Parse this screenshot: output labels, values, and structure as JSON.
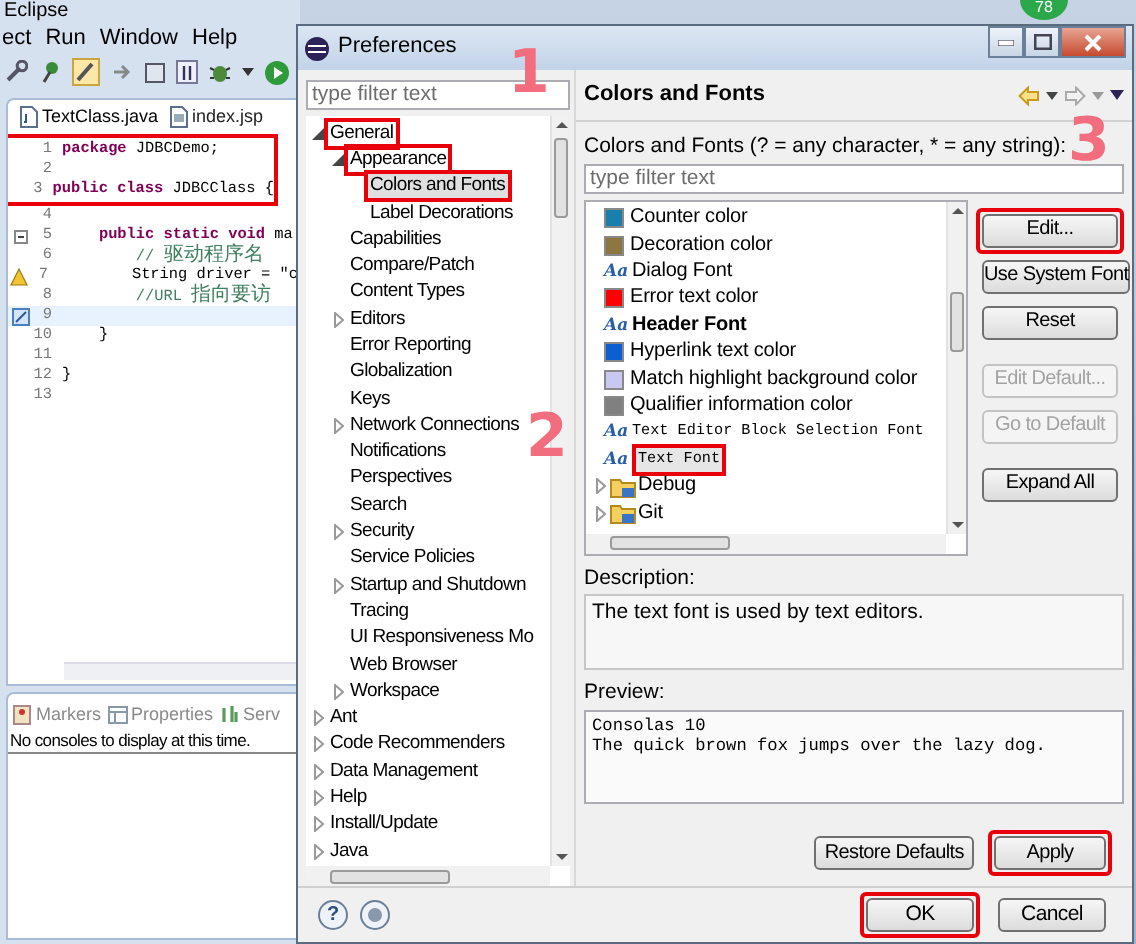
{
  "desktop": {
    "badge": "78"
  },
  "eclipse": {
    "title": "Eclipse",
    "menu": [
      "ect",
      "Run",
      "Window",
      "Help"
    ],
    "editor_tabs": [
      {
        "label": "TextClass.java",
        "selected": true
      },
      {
        "label": "index.jsp",
        "selected": false
      }
    ],
    "code_lines": [
      {
        "number": "1",
        "kind": "code",
        "text": "**package** JDBCDemo;",
        "highlighted": true,
        "current": false
      },
      {
        "number": "2",
        "kind": "blank",
        "highlighted": true,
        "current": false
      },
      {
        "number": "3",
        "kind": "code",
        "text": "**public** **class** JDBCClass {",
        "highlighted": true,
        "current": false
      },
      {
        "number": "4",
        "kind": "blank",
        "highlighted": false,
        "current": false
      },
      {
        "number": "5",
        "kind": "code",
        "text": "    **public** **static** **void** ma",
        "highlighted": false,
        "current": false
      },
      {
        "number": "6",
        "kind": "comment",
        "text": "        // 驱动程序名",
        "highlighted": false,
        "current": false
      },
      {
        "number": "7",
        "kind": "code",
        "text": "        String driver = \"c",
        "highlighted": false,
        "current": false
      },
      {
        "number": "8",
        "kind": "comment",
        "text": "        //URL 指向要访",
        "highlighted": false,
        "current": false
      },
      {
        "number": "9",
        "kind": "blank",
        "highlighted": false,
        "current": true
      },
      {
        "number": "10",
        "kind": "code",
        "text": "    }",
        "highlighted": false,
        "current": false
      },
      {
        "number": "11",
        "kind": "blank",
        "highlighted": false,
        "current": false
      },
      {
        "number": "12",
        "kind": "code",
        "text": "}",
        "highlighted": false,
        "current": false
      },
      {
        "number": "13",
        "kind": "blank",
        "highlighted": false,
        "current": false
      }
    ],
    "bottom_tabs": [
      "Markers",
      "Properties",
      "Serv"
    ],
    "console_message": "No consoles to display at this time."
  },
  "preferences": {
    "title": "Preferences",
    "filter_placeholder": "type filter text",
    "tree": [
      {
        "label": "General",
        "expanded": true,
        "selected": false,
        "highlighted": true,
        "children": [
          {
            "label": "Appearance",
            "expanded": true,
            "selected": false,
            "highlighted": true,
            "children": [
              {
                "label": "Colors and Fonts",
                "selected": true,
                "highlighted": true
              },
              {
                "label": "Label Decorations",
                "selected": false,
                "highlighted": false
              }
            ]
          },
          {
            "label": "Capabilities",
            "selected": false,
            "highlighted": false
          },
          {
            "label": "Compare/Patch",
            "selected": false,
            "highlighted": false
          },
          {
            "label": "Content Types",
            "selected": false,
            "highlighted": false
          },
          {
            "label": "Editors",
            "expanded": false,
            "selected": false,
            "highlighted": false
          },
          {
            "label": "Error Reporting",
            "selected": false,
            "highlighted": false
          },
          {
            "label": "Globalization",
            "selected": false,
            "highlighted": false
          },
          {
            "label": "Keys",
            "selected": false,
            "highlighted": false
          },
          {
            "label": "Network Connections",
            "expanded": false,
            "selected": false,
            "highlighted": false
          },
          {
            "label": "Notifications",
            "selected": false,
            "highlighted": false
          },
          {
            "label": "Perspectives",
            "selected": false,
            "highlighted": false
          },
          {
            "label": "Search",
            "selected": false,
            "highlighted": false
          },
          {
            "label": "Security",
            "expanded": false,
            "selected": false,
            "highlighted": false
          },
          {
            "label": "Service Policies",
            "selected": false,
            "highlighted": false
          },
          {
            "label": "Startup and Shutdown",
            "expanded": false,
            "selected": false,
            "highlighted": false
          },
          {
            "label": "Tracing",
            "selected": false,
            "highlighted": false
          },
          {
            "label": "UI Responsiveness Mo",
            "selected": false,
            "highlighted": false
          },
          {
            "label": "Web Browser",
            "selected": false,
            "highlighted": false
          },
          {
            "label": "Workspace",
            "expanded": false,
            "selected": false,
            "highlighted": false
          }
        ]
      },
      {
        "label": "Ant",
        "expanded": false,
        "selected": false,
        "highlighted": false
      },
      {
        "label": "Code Recommenders",
        "expanded": false,
        "selected": false,
        "highlighted": false
      },
      {
        "label": "Data Management",
        "expanded": false,
        "selected": false,
        "highlighted": false
      },
      {
        "label": "Help",
        "expanded": false,
        "selected": false,
        "highlighted": false
      },
      {
        "label": "Install/Update",
        "expanded": false,
        "selected": false,
        "highlighted": false
      },
      {
        "label": "Java",
        "expanded": false,
        "selected": false,
        "highlighted": false
      }
    ],
    "page_title": "Colors and Fonts",
    "filter_label": "Colors and Fonts (? = any character, * = any string):",
    "page_filter_placeholder": "type filter text",
    "entries": [
      {
        "kind": "color",
        "label": "Counter color",
        "color": "#1b7fad",
        "selected": false,
        "highlighted": false
      },
      {
        "kind": "color",
        "label": "Decoration color",
        "color": "#8c7740",
        "selected": false,
        "highlighted": false
      },
      {
        "kind": "font",
        "label": "Dialog Font",
        "icon": "Aa",
        "selected": false,
        "highlighted": false
      },
      {
        "kind": "color",
        "label": "Error text color",
        "color": "#ff0000",
        "selected": false,
        "highlighted": false
      },
      {
        "kind": "font-bold",
        "label": "Header Font",
        "icon": "Aa",
        "selected": false,
        "highlighted": false
      },
      {
        "kind": "color",
        "label": "Hyperlink text color",
        "color": "#0b5fd0",
        "selected": false,
        "highlighted": false
      },
      {
        "kind": "color",
        "label": "Match highlight background color",
        "color": "#c8c8f0",
        "selected": false,
        "highlighted": false
      },
      {
        "kind": "color",
        "label": "Qualifier information color",
        "color": "#808080",
        "selected": false,
        "highlighted": false
      },
      {
        "kind": "font-mono",
        "label": "Text Editor Block Selection Font",
        "icon": "Aa",
        "selected": false,
        "highlighted": false
      },
      {
        "kind": "font-mono",
        "label": "Text Font",
        "icon": "Aa",
        "selected": true,
        "highlighted": true
      },
      {
        "kind": "category",
        "label": "Debug",
        "expanded": false,
        "selected": false,
        "highlighted": false
      },
      {
        "kind": "category",
        "label": "Git",
        "expanded": false,
        "selected": false,
        "highlighted": false
      }
    ],
    "side_buttons": [
      [
        {
          "label": "Edit...",
          "disabled": false,
          "highlighted": true
        },
        {
          "label": "Use System Font",
          "disabled": false,
          "highlighted": false
        },
        {
          "label": "Reset",
          "disabled": false,
          "highlighted": false
        }
      ],
      [
        {
          "label": "Edit Default...",
          "disabled": true,
          "highlighted": false
        },
        {
          "label": "Go to Default",
          "disabled": true,
          "highlighted": false
        }
      ],
      [
        {
          "label": "Expand All",
          "disabled": false,
          "highlighted": false
        }
      ]
    ],
    "description_label": "Description:",
    "description": "The text font is used by text editors.",
    "preview_label": "Preview:",
    "preview_lines": [
      "Consolas 10",
      "The quick brown fox jumps over the lazy dog."
    ],
    "page_buttons": [
      {
        "label": "Restore Defaults",
        "highlighted": false
      },
      {
        "label": "Apply",
        "highlighted": true
      }
    ],
    "help_button": "?",
    "dialog_buttons": [
      {
        "label": "OK",
        "highlighted": true
      },
      {
        "label": "Cancel",
        "highlighted": false
      }
    ]
  },
  "annotations": [
    {
      "text": "1"
    },
    {
      "text": "2"
    },
    {
      "text": "3"
    }
  ]
}
